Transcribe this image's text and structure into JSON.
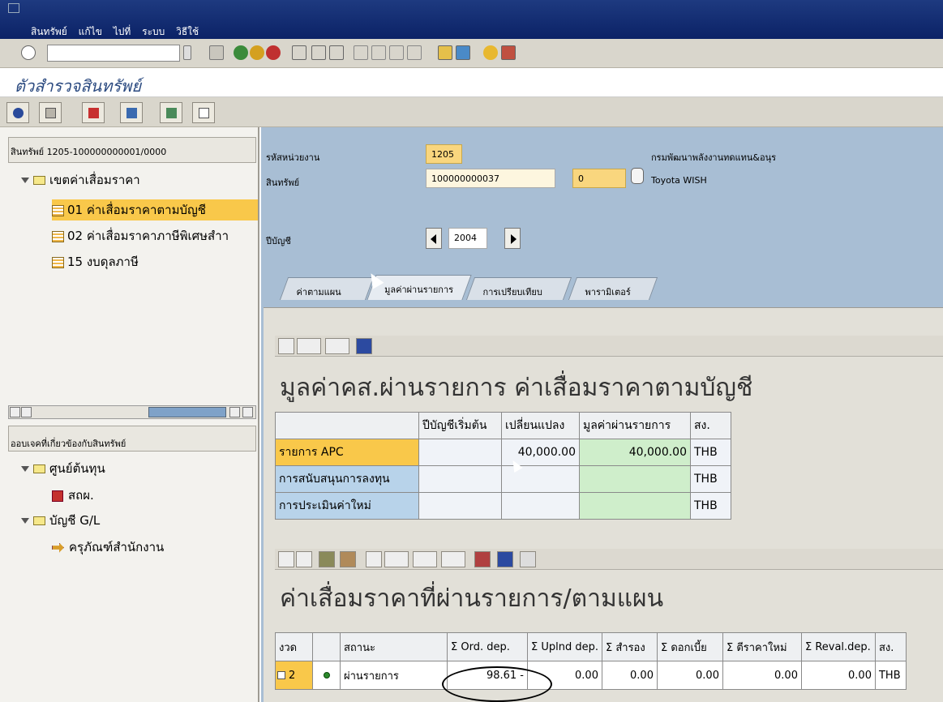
{
  "menu": [
    "สินทรัพย์",
    "แก้ไข",
    "ไปที่",
    "ระบบ",
    "วิธีใช้"
  ],
  "page_title": "ตัวสำรวจสินทรัพย์",
  "left": {
    "asset_header": "สินทรัพย์ 1205-100000000001/0000",
    "tree": [
      {
        "label": "เขตค่าเสื่อมราคา"
      },
      {
        "label": "01 ค่าเสื่อมราคาตามบัญชี"
      },
      {
        "label": "02 ค่าเสื่อมราคาภาษีพิเศษสำา"
      },
      {
        "label": "15 งบดุลภาษี"
      }
    ],
    "objects_header": "ออบเจคที่เกี่ยวข้องกับสินทรัพย์",
    "objects": [
      {
        "label": "ศูนย์ต้นทุน"
      },
      {
        "label": "สถผ."
      },
      {
        "label": "บัญชี G/L"
      },
      {
        "label": "ครุภัณฑ์สำนักงาน"
      }
    ]
  },
  "form": {
    "company_code_label": "รหัสหน่วยงาน",
    "company_code": "1205",
    "company_name": "กรมพัฒนาพลังงานทดแทน&อนุร",
    "asset_label": "สินทรัพย์",
    "asset_number": "100000000037",
    "asset_sub": "0",
    "asset_desc": "Toyota WISH  ",
    "fiscal_year_label": "ปีบัญชี",
    "fiscal_year": "2004"
  },
  "tabs": [
    "ค่าตามแผน",
    "มูลค่าผ่านรายการ",
    "การเปรียบเทียบ",
    "พารามิเตอร์"
  ],
  "table1": {
    "title": "มูลค่าคส.ผ่านรายการ ค่าเสื่อมราคาตามบัญชี",
    "headers": [
      "",
      "ปีบัญชีเริ่มต้น",
      "เปลี่ยนแปลง",
      "มูลค่าผ่านรายการ",
      "สง."
    ],
    "rows": [
      {
        "label": "รายการ APC",
        "start": "",
        "change": "40,000.00",
        "posted": "40,000.00",
        "curr": "THB"
      },
      {
        "label": "การสนับสนุนการลงทุน",
        "start": "",
        "change": "",
        "posted": "",
        "curr": "THB"
      },
      {
        "label": "การประเมินค่าใหม่",
        "start": "",
        "change": "",
        "posted": "",
        "curr": "THB"
      }
    ]
  },
  "table2": {
    "title": "ค่าเสื่อมราคาที่ผ่านรายการ/ตามแผน",
    "headers": [
      "งวด",
      "",
      "สถานะ",
      "Σ Ord. dep.",
      "Σ Uplnd dep.",
      "Σ สำรอง",
      "Σ ดอกเบี้ย",
      "Σ ตีราคาใหม่",
      "Σ Reval.dep.",
      "สง."
    ],
    "rows": [
      {
        "period": "2",
        "status": "ผ่านรายการ",
        "ord": "98.61 -",
        "upl": "0.00",
        "res": "0.00",
        "int": "0.00",
        "reval": "0.00",
        "revaldep": "0.00",
        "curr": "THB"
      }
    ]
  }
}
